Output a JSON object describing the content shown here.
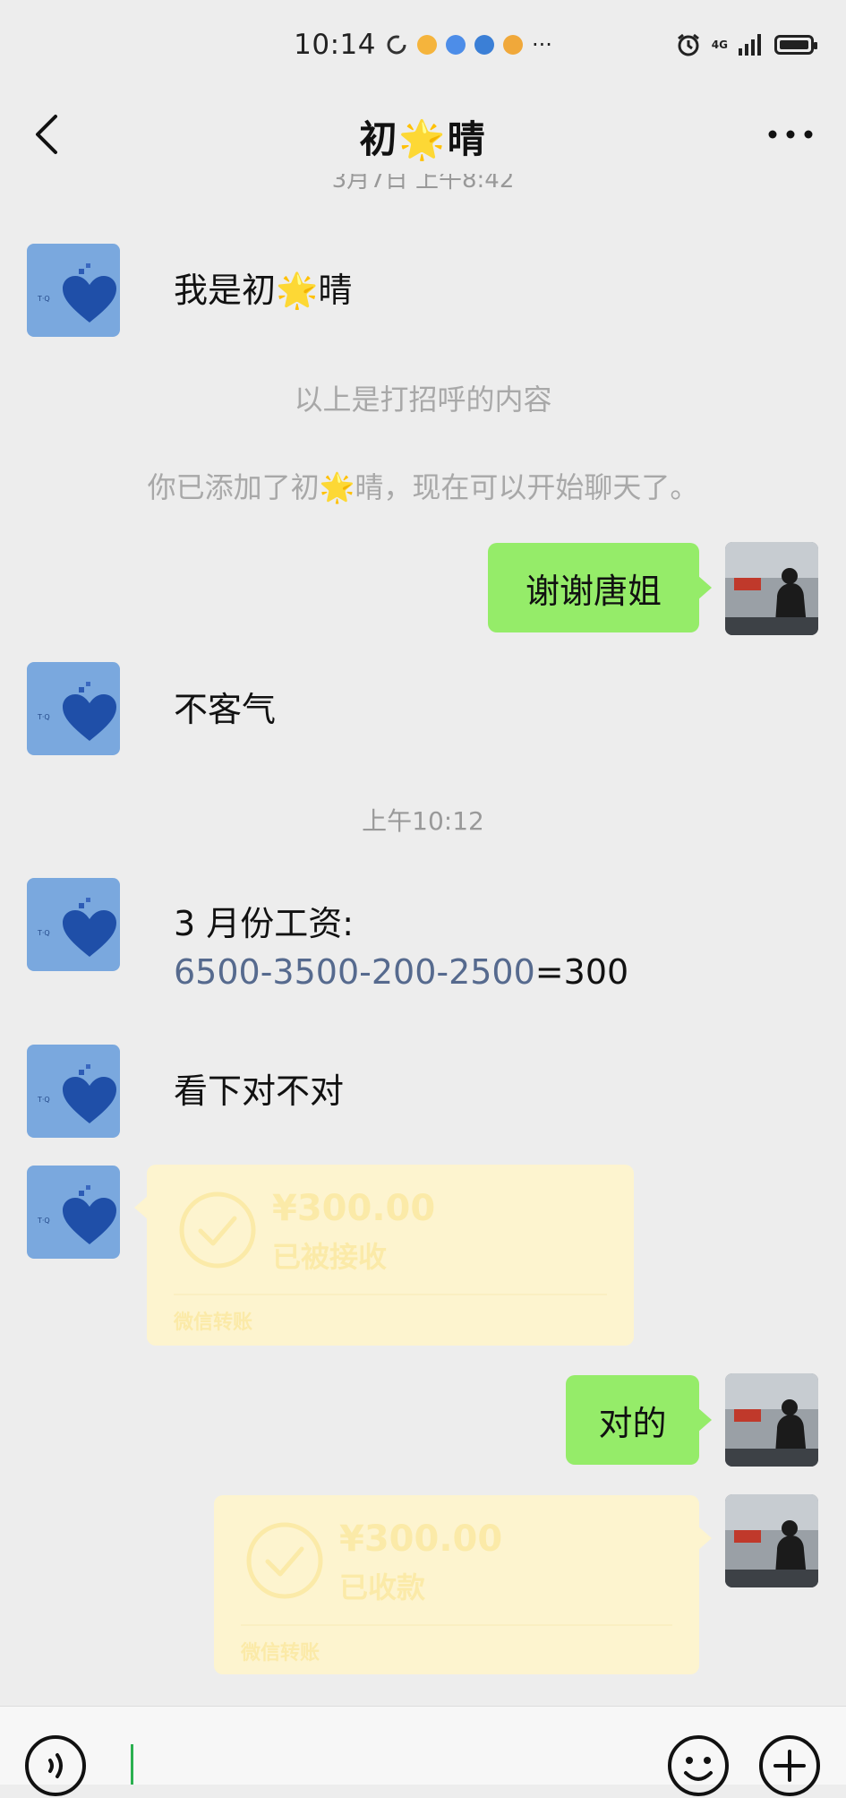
{
  "status_bar": {
    "time": "10:14",
    "more": "···",
    "network": "4G"
  },
  "header": {
    "title": "初🌟晴"
  },
  "messages": {
    "partial_timestamp": "3月7日 上午8:42",
    "greeting_text": "我是初🌟晴",
    "greeting_note": "以上是打招呼的内容",
    "added_note": "你已添加了初🌟晴，现在可以开始聊天了。",
    "thanks_text": "谢谢唐姐",
    "reply_text": "不客气",
    "time_label": "上午10:12",
    "salary_line1": "3 月份工资:",
    "salary_formula": "6500-3500-200-2500",
    "salary_result": "=300",
    "check_text": "看下对不对",
    "confirm_text": "对的"
  },
  "transfer_received": {
    "amount": "¥300.00",
    "status": "已被接收",
    "footer": "微信转账"
  },
  "transfer_collected": {
    "amount": "¥300.00",
    "status": "已收款",
    "footer": "微信转账"
  },
  "colors": {
    "chat_background": "#ededed",
    "sent_bubble": "#95ec69",
    "transfer_card": "#fdf4cf",
    "link_text": "#566a8e",
    "cursor": "#2bb050"
  },
  "icons": {
    "back": "chevron-left-icon",
    "more": "more-horizontal-icon",
    "voice": "voice-icon",
    "emoji": "smiley-icon",
    "plus": "plus-icon",
    "transfer_check": "check-circle-icon"
  }
}
